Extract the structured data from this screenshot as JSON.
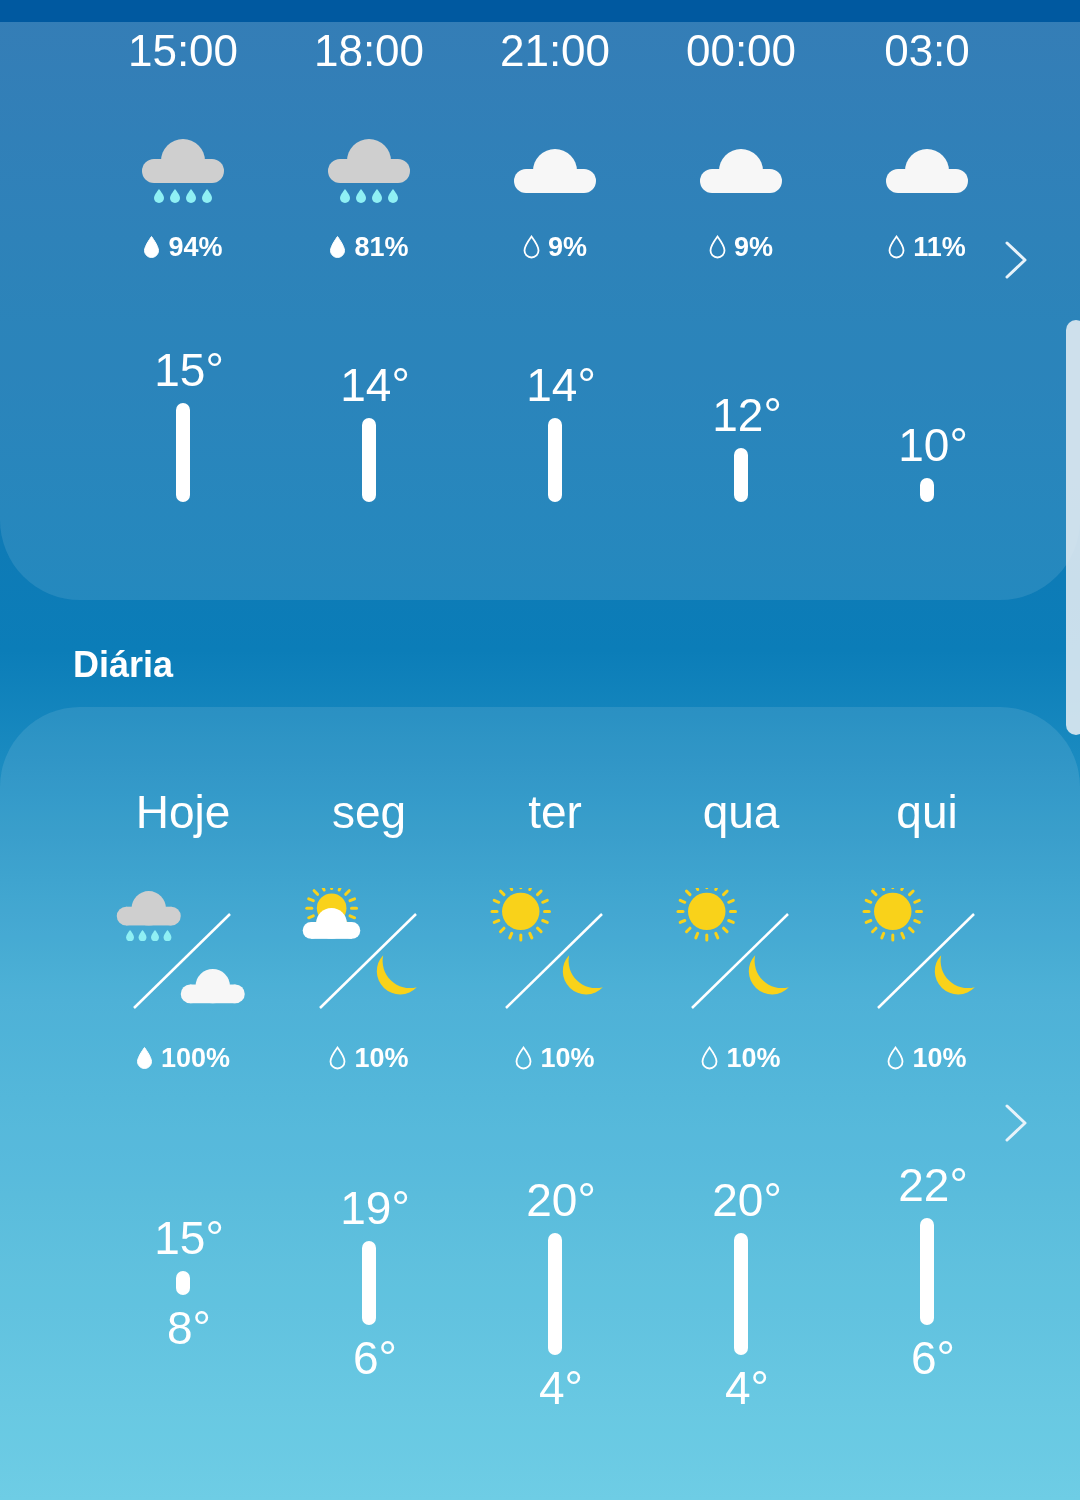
{
  "hourly": {
    "hours": [
      {
        "time": "15:00",
        "kind": "rain",
        "precip": "94%",
        "precip_high": true,
        "temp": "15°"
      },
      {
        "time": "18:00",
        "kind": "rain",
        "precip": "81%",
        "precip_high": true,
        "temp": "14°"
      },
      {
        "time": "21:00",
        "kind": "cloud",
        "precip": "9%",
        "precip_high": false,
        "temp": "14°"
      },
      {
        "time": "00:00",
        "kind": "cloud",
        "precip": "9%",
        "precip_high": false,
        "temp": "12°"
      },
      {
        "time": "03:0",
        "kind": "cloud",
        "precip": "11%",
        "precip_high": false,
        "temp": "10°"
      }
    ]
  },
  "daily": {
    "title": "Diária",
    "days": [
      {
        "day": "Hoje",
        "day_weather": {
          "kind": "rain"
        },
        "night_weather": {
          "kind": "cloud"
        },
        "precip": "100%",
        "precip_high": true,
        "high": "15°",
        "low": "8°"
      },
      {
        "day": "seg",
        "day_weather": {
          "kind": "partly_sunny"
        },
        "night_weather": {
          "kind": "moon"
        },
        "precip": "10%",
        "precip_high": false,
        "high": "19°",
        "low": "6°"
      },
      {
        "day": "ter",
        "day_weather": {
          "kind": "sun"
        },
        "night_weather": {
          "kind": "moon"
        },
        "precip": "10%",
        "precip_high": false,
        "high": "20°",
        "low": "4°"
      },
      {
        "day": "qua",
        "day_weather": {
          "kind": "sun"
        },
        "night_weather": {
          "kind": "moon"
        },
        "precip": "10%",
        "precip_high": false,
        "high": "20°",
        "low": "4°"
      },
      {
        "day": "qui",
        "day_weather": {
          "kind": "sun"
        },
        "night_weather": {
          "kind": "moon"
        },
        "precip": "10%",
        "precip_high": false,
        "high": "22°",
        "low": "6°"
      }
    ]
  }
}
